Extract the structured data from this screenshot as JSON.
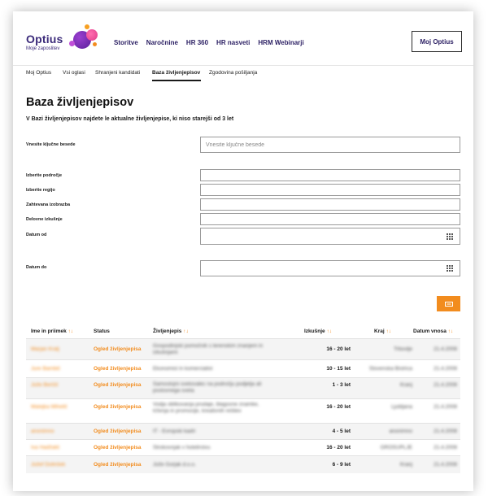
{
  "brand": {
    "name": "Optius",
    "tagline": "Moje zaposlitev"
  },
  "nav": {
    "items": [
      "Storitve",
      "Naročnine",
      "HR 360",
      "HR nasveti",
      "HRM Webinarji"
    ],
    "account_button": "Moj Optius"
  },
  "tabs": [
    "Moj Optius",
    "Vsi oglasi",
    "Shranjeni kandidati",
    "Baza življenjepisov",
    "Zgodovina pošiljanja"
  ],
  "page": {
    "title": "Baza življenjepisov",
    "description": "V Bazi življenjepisov najdete le aktualne življenjepise, ki niso starejši od 3 let"
  },
  "form": {
    "keywords_label": "Vnesite ključne besede",
    "keywords_placeholder": "Vnesite ključne besede",
    "area_label": "Izberite področje",
    "region_label": "Izberite regijo",
    "education_label": "Zahtevana izobrazba",
    "experience_label": "Delovne izkušnje",
    "date_from_label": "Datum od",
    "date_to_label": "Datum do",
    "search_icon": "search-icon"
  },
  "table": {
    "headers": [
      "Ime in priimek",
      "Status",
      "Življenjepis",
      "Izkušnje",
      "Kraj",
      "Datum vnosa"
    ],
    "rows": [
      {
        "name": "Marjan Kralj",
        "status": "Ogled življenjepisa",
        "cv": "Gospodinjski pomočnik s terenskim znanjem in izkušnjami",
        "experience": "16 - 20 let",
        "place": "Trbovlje",
        "date": "21.4.2008"
      },
      {
        "name": "Jure Bambič",
        "status": "Ogled življenjepisa",
        "cv": "Ekonomist in komercialist",
        "experience": "10 - 15 let",
        "place": "Slovenska Bistrica",
        "date": "21.4.2008"
      },
      {
        "name": "Jože Berčič",
        "status": "Ogled življenjepisa",
        "cv": "Samostojni svetovalec na področju podjetja ali poslovnega sveta",
        "experience": "1 - 3 let",
        "place": "Kranj",
        "date": "21.4.2008"
      },
      {
        "name": "Matejka Mihelič",
        "status": "Ogled življenjepisa",
        "cv": "Vodja oblikovanja prodaje, blagovne znamke, trženja in promocije, kreativnih rešitev",
        "experience": "16 - 20 let",
        "place": "Ljubljana",
        "date": "21.4.2008"
      },
      {
        "name": "anonimno",
        "status": "Ogled življenjepisa",
        "cv": "IT - Evropski kadri",
        "experience": "4 - 5 let",
        "place": "anonimno",
        "date": "21.4.2008"
      },
      {
        "name": "Iva Hadžalić",
        "status": "Ogled življenjepisa",
        "cv": "Strokovnjak v hotelirstvu",
        "experience": "16 - 20 let",
        "place": "GROSUPLJE",
        "date": "21.4.2008"
      },
      {
        "name": "Jožef Dolinšek",
        "status": "Ogled življenjepisa",
        "cv": "Jože Gorjak d.o.o.",
        "experience": "6 - 9 let",
        "place": "Kranj",
        "date": "21.4.2008"
      }
    ]
  },
  "colors": {
    "accent": "#f28c1e",
    "brand": "#3b2a7a"
  }
}
